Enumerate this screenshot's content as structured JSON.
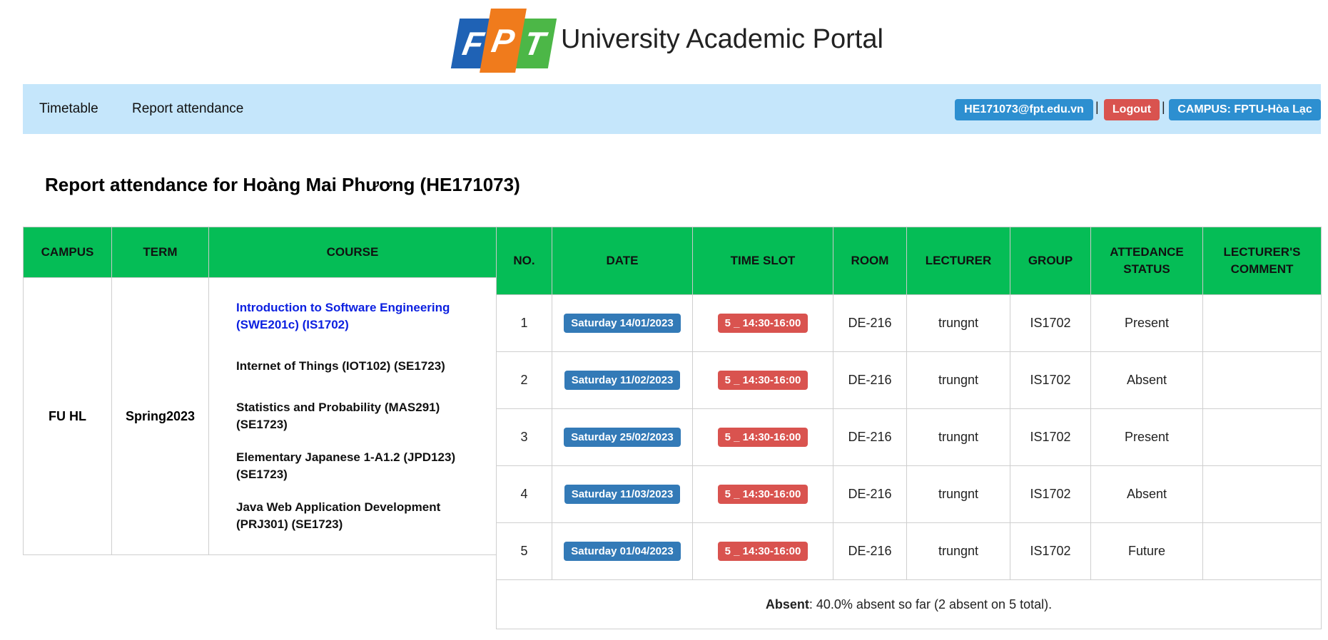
{
  "header": {
    "logo_letters": [
      "F",
      "P",
      "T"
    ],
    "title": "University Academic Portal"
  },
  "nav": {
    "timetable": "Timetable",
    "report_attendance": "Report attendance",
    "email": "HE171073@fpt.edu.vn",
    "separator": "|",
    "logout": "Logout",
    "campus": "CAMPUS: FPTU-Hòa Lạc"
  },
  "page": {
    "heading": "Report attendance for Hoàng Mai Phương (HE171073)"
  },
  "left_table": {
    "headers": {
      "campus": "CAMPUS",
      "term": "TERM",
      "course": "COURSE"
    },
    "campus": "FU HL",
    "term": "Spring2023",
    "courses": [
      "Introduction to Software Engineering (SWE201c) (IS1702)",
      "Internet of Things (IOT102) (SE1723)",
      "Statistics and Probability (MAS291) (SE1723)",
      "Elementary Japanese 1-A1.2 (JPD123) (SE1723)",
      "Java Web Application Development (PRJ301) (SE1723)"
    ]
  },
  "right_table": {
    "headers": {
      "no": "NO.",
      "date": "DATE",
      "slot": "TIME SLOT",
      "room": "ROOM",
      "lecturer": "LECTURER",
      "group": "GROUP",
      "status": "ATTEDANCE STATUS",
      "comment": "LECTURER'S COMMENT"
    },
    "rows": [
      {
        "no": "1",
        "date": "Saturday 14/01/2023",
        "slot": "5 _ 14:30-16:00",
        "room": "DE-216",
        "lecturer": "trungnt",
        "group": "IS1702",
        "status": "Present",
        "comment": ""
      },
      {
        "no": "2",
        "date": "Saturday 11/02/2023",
        "slot": "5 _ 14:30-16:00",
        "room": "DE-216",
        "lecturer": "trungnt",
        "group": "IS1702",
        "status": "Absent",
        "comment": ""
      },
      {
        "no": "3",
        "date": "Saturday 25/02/2023",
        "slot": "5 _ 14:30-16:00",
        "room": "DE-216",
        "lecturer": "trungnt",
        "group": "IS1702",
        "status": "Present",
        "comment": ""
      },
      {
        "no": "4",
        "date": "Saturday 11/03/2023",
        "slot": "5 _ 14:30-16:00",
        "room": "DE-216",
        "lecturer": "trungnt",
        "group": "IS1702",
        "status": "Absent",
        "comment": ""
      },
      {
        "no": "5",
        "date": "Saturday 01/04/2023",
        "slot": "5 _ 14:30-16:00",
        "room": "DE-216",
        "lecturer": "trungnt",
        "group": "IS1702",
        "status": "Future",
        "comment": ""
      }
    ],
    "summary_label": "Absent",
    "summary_text": ": 40.0% absent so far (2 absent on 5 total)."
  },
  "colors": {
    "nav_bg": "#c5e6fb",
    "table_header_bg": "#05bd56",
    "badge_blue": "#337ab7",
    "badge_red": "#d9534f",
    "present": "#1a7a1a",
    "absent": "#e02020",
    "active_course": "#0b1fe0"
  }
}
